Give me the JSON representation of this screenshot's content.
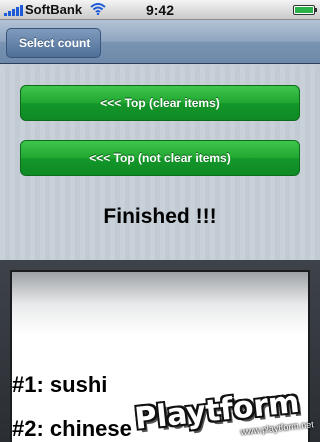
{
  "status_bar": {
    "carrier": "SoftBank",
    "time": "9:42"
  },
  "nav_bar": {
    "back_label": "Select count"
  },
  "main": {
    "buttons": [
      {
        "label": "<<< Top (clear items)"
      },
      {
        "label": "<<< Top (not clear items)"
      }
    ],
    "message": "Finished !!!"
  },
  "picker": {
    "rows": [
      "#1: sushi",
      "#2: chinese"
    ]
  },
  "watermark": {
    "logo": "Playtform",
    "url": "www.playtform.net"
  },
  "colors": {
    "button_green": "#21a631",
    "nav_blue": "#6d88aa"
  }
}
